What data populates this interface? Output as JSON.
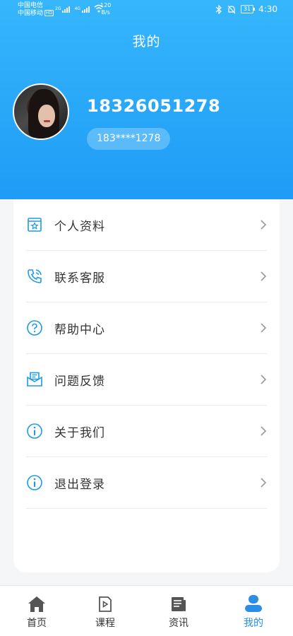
{
  "status_bar": {
    "carrier1": "中国电信",
    "carrier2": "中国移动",
    "hd": "HD",
    "net1": "2G",
    "net2": "4G",
    "speed_value": "120",
    "speed_unit": "B/s",
    "battery": "31",
    "time": "4:30"
  },
  "header": {
    "title": "我的"
  },
  "profile": {
    "name": "18326051278",
    "phone_masked": "183****1278"
  },
  "menu": [
    {
      "label": "个人资料",
      "icon": "profile-card-icon"
    },
    {
      "label": "联系客服",
      "icon": "phone-icon"
    },
    {
      "label": "帮助中心",
      "icon": "help-icon"
    },
    {
      "label": "问题反馈",
      "icon": "feedback-mail-icon"
    },
    {
      "label": "关于我们",
      "icon": "info-icon"
    },
    {
      "label": "退出登录",
      "icon": "info-icon"
    }
  ],
  "tabbar": [
    {
      "label": "首页",
      "icon": "home-icon",
      "active": false
    },
    {
      "label": "课程",
      "icon": "course-icon",
      "active": false
    },
    {
      "label": "资讯",
      "icon": "news-icon",
      "active": false
    },
    {
      "label": "我的",
      "icon": "user-icon",
      "active": true
    }
  ],
  "colors": {
    "header_gradient_top": "#36b6fb",
    "header_gradient_bottom": "#1e9cf6",
    "icon_blue": "#1e9be6",
    "tab_active": "#2a8de6",
    "tab_inactive": "#555555"
  }
}
